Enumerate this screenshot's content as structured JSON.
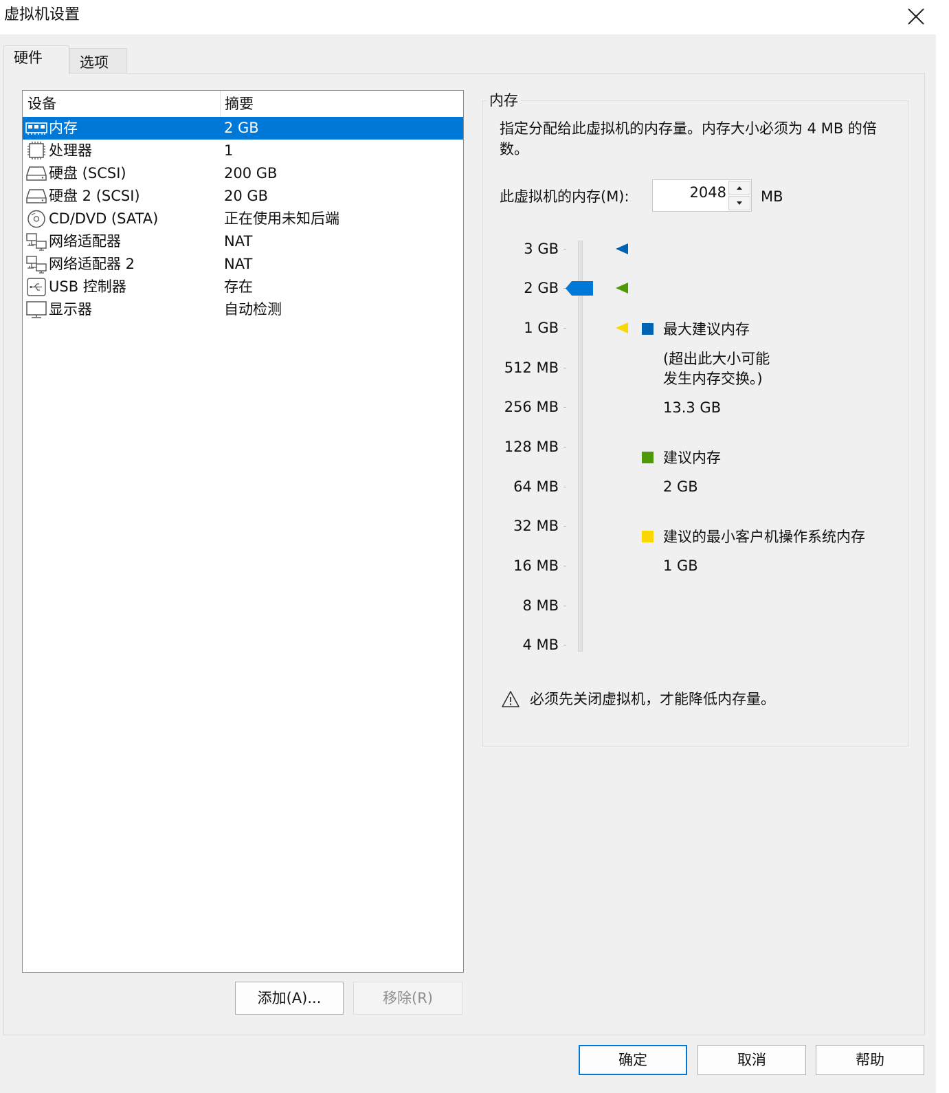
{
  "window": {
    "title": "虚拟机设置"
  },
  "tabs": [
    {
      "label": "硬件",
      "active": true
    },
    {
      "label": "选项",
      "active": false
    }
  ],
  "device_list": {
    "headers": {
      "device": "设备",
      "summary": "摘要"
    },
    "rows": [
      {
        "icon": "memory-icon",
        "name": "内存",
        "summary": "2 GB",
        "selected": true
      },
      {
        "icon": "processor-icon",
        "name": "处理器",
        "summary": "1"
      },
      {
        "icon": "hard-disk-icon",
        "name": "硬盘 (SCSI)",
        "summary": "200 GB"
      },
      {
        "icon": "hard-disk-icon",
        "name": "硬盘 2 (SCSI)",
        "summary": "20 GB"
      },
      {
        "icon": "cd-dvd-icon",
        "name": "CD/DVD (SATA)",
        "summary": "正在使用未知后端"
      },
      {
        "icon": "network-adapter-icon",
        "name": "网络适配器",
        "summary": "NAT"
      },
      {
        "icon": "network-adapter-icon",
        "name": "网络适配器 2",
        "summary": "NAT"
      },
      {
        "icon": "usb-icon",
        "name": "USB 控制器",
        "summary": "存在"
      },
      {
        "icon": "display-icon",
        "name": "显示器",
        "summary": "自动检测"
      }
    ]
  },
  "list_buttons": {
    "add": "添加(A)...",
    "remove": "移除(R)"
  },
  "memory": {
    "group_title": "内存",
    "description": "指定分配给此虚拟机的内存量。内存大小必须为 4 MB 的倍数。",
    "input_label": "此虚拟机的内存(M):",
    "value": "2048",
    "unit": "MB",
    "scale_labels": [
      "3 GB",
      "2 GB",
      "1 GB",
      "512 MB",
      "256 MB",
      "128 MB",
      "64 MB",
      "32 MB",
      "16 MB",
      "8 MB",
      "4 MB"
    ],
    "slider_value": "2 GB",
    "legend": [
      {
        "color": "#0063b1",
        "title": "最大建议内存",
        "note_line1": "(超出此大小可能",
        "note_line2": "发生内存交换。)",
        "value": "13.3 GB"
      },
      {
        "color": "#4e9a06",
        "title": "建议内存",
        "value": "2 GB"
      },
      {
        "color": "#f8d800",
        "title": "建议的最小客户机操作系统内存",
        "value": "1 GB"
      }
    ],
    "warning": "必须先关闭虚拟机，才能降低内存量。"
  },
  "dialog_buttons": {
    "ok": "确定",
    "cancel": "取消",
    "help": "帮助"
  },
  "colors": {
    "selection": "#0078d7",
    "max_marker": "#0063b1",
    "recommended_marker": "#4e9a06",
    "min_marker": "#f8d800"
  }
}
